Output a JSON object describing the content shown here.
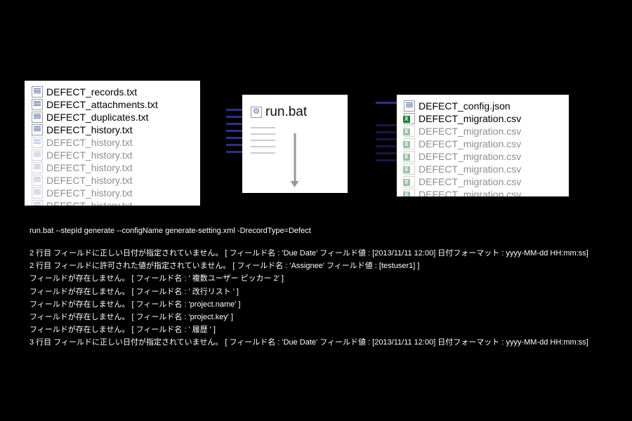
{
  "left_files": {
    "visible": [
      "DEFECT_records.txt",
      "DEFECT_attachments.txt",
      "DEFECT_duplicates.txt",
      "DEFECT_history.txt"
    ],
    "faded_repeat": "DEFECT_history.txt"
  },
  "mid": {
    "label": "run.bat"
  },
  "right_files": {
    "json": "DEFECT_config.json",
    "csv": "DEFECT_migration.csv",
    "faded_repeat": "DEFECT_migration.csv"
  },
  "console": {
    "command": "run.bat --stepId generate --configName generate-setting.xml -DrecordType=Defect",
    "lines": [
      "2 行目 フィールドに正しい日付が指定されていません。 [ フィールド名 : 'Due Date' フィールド値 : [2013/11/11 12:00] 日付フォーマット : yyyy-MM-dd HH:mm:ss]",
      "2 行目 フィールドに許可された値が指定されていません。 [ フィールド名 : 'Assignee' フィールド値 : [testuser1] ]",
      "フィールドが存在しません。 [ フィールド名 : ' 複数ユーザー ピッカー 2' ]",
      "フィールドが存在しません。 [ フィールド名 : ' 改行リスト ' ]",
      "フィールドが存在しません。 [ フィールド名 : 'project.name' ]",
      "フィールドが存在しません。 [ フィールド名 : 'project.key' ]",
      "フィールドが存在しません。 [ フィールド名 : ' 履歴 ' ]",
      "3 行目 フィールドに正しい日付が指定されていません。 [ フィールド名 : 'Due Date' フィールド値 : [2013/11/11 12:00] 日付フォーマット : yyyy-MM-dd HH:mm:ss]"
    ]
  },
  "colors": {
    "arrow": "#2f2f8f",
    "bg": "#000000"
  }
}
